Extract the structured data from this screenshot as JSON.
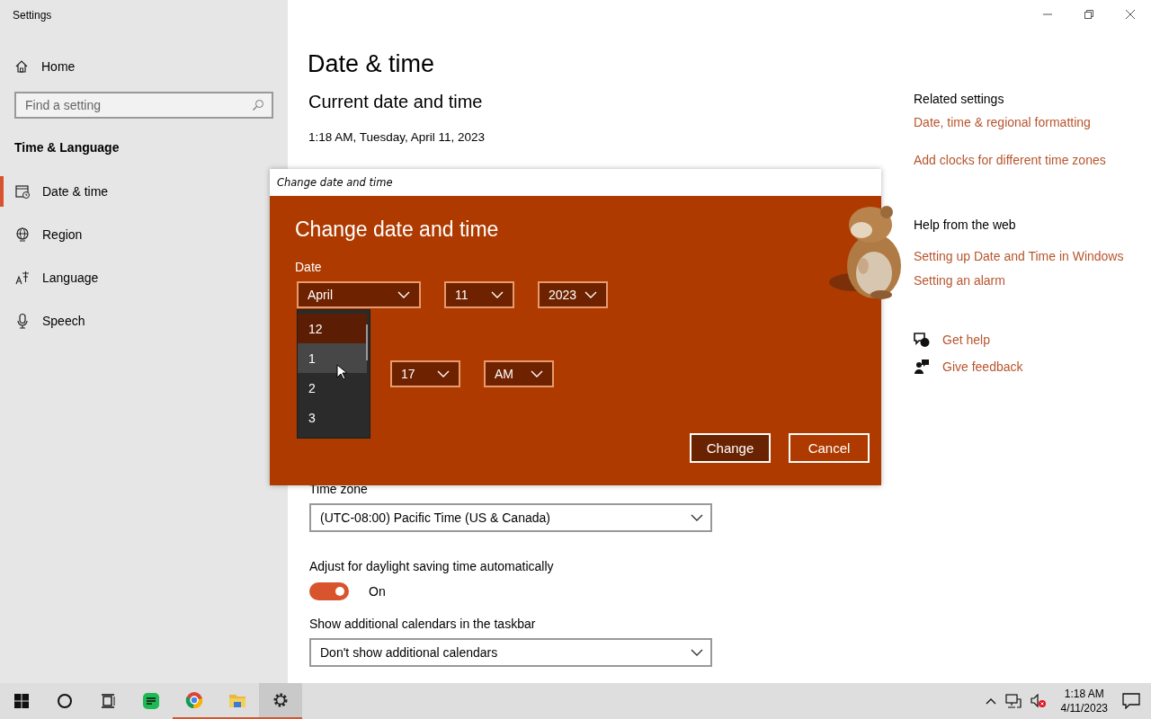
{
  "window": {
    "title": "Settings"
  },
  "sidebar": {
    "home": "Home",
    "search": {
      "placeholder": "Find a setting"
    },
    "section": "Time & Language",
    "items": [
      {
        "label": "Date & time",
        "kind": "calendar",
        "selected": true
      },
      {
        "label": "Region",
        "kind": "globe",
        "selected": false
      },
      {
        "label": "Language",
        "kind": "language",
        "selected": false
      },
      {
        "label": "Speech",
        "kind": "mic",
        "selected": false
      }
    ]
  },
  "main": {
    "title": "Date & time",
    "subtitle": "Current date and time",
    "current": "1:18 AM, Tuesday, April 11, 2023",
    "time_zone": {
      "label": "Time zone",
      "value": "(UTC-08:00) Pacific Time (US & Canada)"
    },
    "daylight": {
      "label": "Adjust for daylight saving time automatically",
      "on": true,
      "state_label": "On"
    },
    "calendars": {
      "label": "Show additional calendars in the taskbar",
      "value": "Don't show additional calendars"
    }
  },
  "related": {
    "heading": "Related settings",
    "links": [
      "Date, time & regional formatting",
      "Add clocks for different time zones"
    ]
  },
  "help": {
    "heading": "Help from the web",
    "links": [
      "Setting up Date and Time in Windows",
      "Setting an alarm"
    ]
  },
  "support": [
    {
      "label": "Get help",
      "kind": "help"
    },
    {
      "label": "Give feedback",
      "kind": "feedback"
    }
  ],
  "dialog": {
    "title": "Change date and time",
    "heading": "Change date and time",
    "date_label": "Date",
    "date_fields": [
      "April",
      "11",
      "2023"
    ],
    "time_fields": [
      "17",
      "AM"
    ],
    "hour_options": [
      {
        "label": "12",
        "selected": true,
        "hovered": false
      },
      {
        "label": "1",
        "selected": false,
        "hovered": true
      },
      {
        "label": "2",
        "selected": false,
        "hovered": false
      },
      {
        "label": "3",
        "selected": false,
        "hovered": false
      }
    ],
    "buttons": [
      {
        "label": "Change",
        "kind": "primary"
      },
      {
        "label": "Cancel",
        "kind": "secondary"
      }
    ]
  },
  "taskbar": {
    "apps": [
      {
        "kind": "start",
        "running": false,
        "selected": false
      },
      {
        "kind": "search",
        "running": false,
        "selected": false
      },
      {
        "kind": "taskview",
        "running": false,
        "selected": false
      },
      {
        "kind": "chat",
        "running": false,
        "selected": false
      },
      {
        "kind": "browser",
        "running": true,
        "selected": false
      },
      {
        "kind": "folder",
        "running": true,
        "selected": false
      },
      {
        "kind": "settings",
        "running": true,
        "selected": true
      }
    ],
    "clock": {
      "time": "1:18 AM",
      "date": "4/11/2023"
    }
  }
}
